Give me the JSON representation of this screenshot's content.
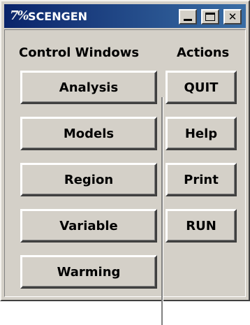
{
  "window": {
    "title": "SCENGEN",
    "icon": "app-logo-icon",
    "icon_text": "7%",
    "title_buttons": {
      "minimize": "minimize-icon",
      "maximize": "maximize-icon",
      "close": "close-icon",
      "close_glyph": "✕"
    }
  },
  "control_windows": {
    "heading": "Control Windows",
    "buttons": [
      "Analysis",
      "Models",
      "Region",
      "Variable",
      "Warming"
    ]
  },
  "actions": {
    "heading": "Actions",
    "buttons": [
      "QUIT",
      "Help",
      "Print",
      "RUN"
    ]
  },
  "colors": {
    "face": "#d4d0c8",
    "titlebar_start": "#0a246a",
    "titlebar_end": "#3a6ea5"
  }
}
